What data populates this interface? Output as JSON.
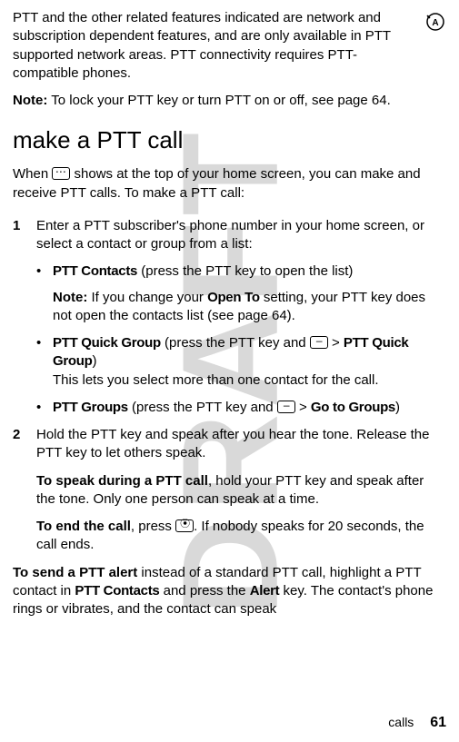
{
  "watermark": "DRAFT",
  "intro": "PTT and the other related features indicated are network and subscription dependent features, and are only available in PTT supported network areas. PTT connectivity requires PTT-compatible phones.",
  "top_icon_name": "network-feature-icon",
  "note_label": "Note:",
  "note_text": " To lock your PTT key or turn PTT on or off, see page 64.",
  "heading": "make a PTT call",
  "when_prefix": "When ",
  "when_suffix": " shows at the top of your home screen, you can make and receive PTT calls. To make a PTT call:",
  "step1_num": "1",
  "step1_text": "Enter a PTT subscriber's phone number in your home screen, or select a contact or group from a list:",
  "b1_label": "PTT Contacts",
  "b1_rest": " (press the PTT key to open the list)",
  "b1_note_label": "Note:",
  "b1_note_text": " If you change your ",
  "b1_note_cond": "Open To",
  "b1_note_text2": " setting, your PTT key does not open the contacts list (see page 64).",
  "b2_label": "PTT Quick Group",
  "b2_mid": " (press the PTT key and ",
  "b2_gt": " > ",
  "b2_label2": "PTT Quick Group",
  "b2_close": ")",
  "b2_line2": "This lets you select more than one contact for the call.",
  "b3_label": "PTT Groups",
  "b3_mid": " (press the PTT key and ",
  "b3_gt": " > ",
  "b3_label2": "Go to Groups",
  "b3_close": ")",
  "step2_num": "2",
  "step2_text": "Hold the PTT key and speak after you hear the tone. Release the PTT key to let others speak.",
  "speak_bold": "To speak during a PTT call",
  "speak_rest": ", hold your PTT key and speak after the tone. Only one person can speak at a time.",
  "end_bold": "To end the call",
  "end_mid": ", press ",
  "end_rest": ". If nobody speaks for 20 seconds, the call ends.",
  "alert_bold": "To send a PTT alert",
  "alert_mid1": " instead of a standard PTT call, highlight a PTT contact in ",
  "alert_cond1": "PTT Contacts",
  "alert_mid2": " and press the ",
  "alert_cond2": "Alert",
  "alert_mid3": " key. The contact's phone rings or vibrates, and the contact can speak",
  "footer_section": "calls",
  "footer_page": "61"
}
